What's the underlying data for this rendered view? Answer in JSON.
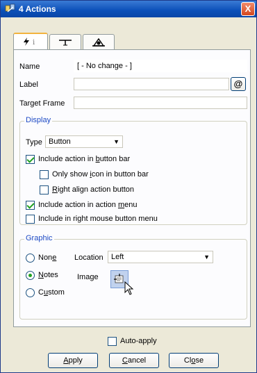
{
  "window": {
    "title": "4 Actions",
    "close_label": "X"
  },
  "tabs": [
    {
      "icon": "lightning-info-icon",
      "active": true
    },
    {
      "icon": "hotspot-icon",
      "active": false
    },
    {
      "icon": "cog-icon",
      "active": false
    }
  ],
  "fields": {
    "name_label": "Name",
    "name_value": "[ - No change - ]",
    "label_label": "Label",
    "label_value": "",
    "label_btn": "@",
    "target_label": "Target Frame",
    "target_value": ""
  },
  "display": {
    "legend": "Display",
    "type_label": "Type",
    "type_value": "Button",
    "include_bar": {
      "pre": "Include action in ",
      "u": "b",
      "post": "utton bar",
      "checked": true
    },
    "only_icon": {
      "pre": "Only show ",
      "u": "i",
      "post": "con in button bar",
      "checked": false
    },
    "right_align": {
      "pre": "",
      "u": "R",
      "post": "ight align action  button",
      "checked": false
    },
    "include_menu": {
      "pre": "Include action in action ",
      "u": "m",
      "post": "enu",
      "checked": true
    },
    "include_right": {
      "pre": "Include in right mouse button menu",
      "u": "",
      "post": "",
      "checked": false
    }
  },
  "graphic": {
    "legend": "Graphic",
    "none": {
      "pre": "Non",
      "u": "e",
      "post": "",
      "checked": false
    },
    "notes": {
      "pre": "",
      "u": "N",
      "post": "otes",
      "checked": true
    },
    "custom": {
      "pre": "C",
      "u": "u",
      "post": "stom",
      "checked": false
    },
    "location_label": "Location",
    "location_value": "Left",
    "image_label": "Image"
  },
  "footer": {
    "auto_apply": "Auto-apply",
    "auto_apply_checked": false,
    "apply": {
      "pre": "",
      "u": "A",
      "post": "pply"
    },
    "cancel": {
      "pre": "",
      "u": "C",
      "post": "ancel"
    },
    "close": {
      "pre": "Cl",
      "u": "o",
      "post": "se"
    }
  },
  "colors": {
    "accent": "#0b4fb8",
    "check": "#21a121",
    "group_legend": "#1c49c4"
  }
}
